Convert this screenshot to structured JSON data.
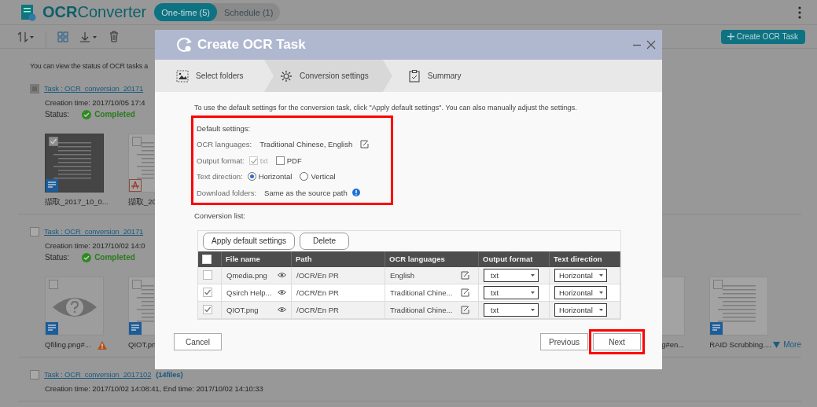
{
  "app": {
    "title": "**OCR**Converter",
    "tabs": [
      {
        "label": "One-time (5)",
        "selected": true
      },
      {
        "label": "Schedule (1)",
        "selected": false
      }
    ]
  },
  "toolbar": {
    "create_button": "Create OCR Task"
  },
  "info_text": "You can view the status of OCR tasks a",
  "tasks": [
    {
      "checked": true,
      "link": "Task : OCR_conversion_20171",
      "time": "Creation time: 2017/10/05 17:4",
      "status_label": "Status:",
      "status": "Completed",
      "thumbnails": [
        {
          "kind": "dark-doc",
          "checked": true,
          "pdf": false,
          "warning": false,
          "label": "擷取_2017_10_0..."
        },
        {
          "kind": "doc-cut",
          "checked": false,
          "pdf": true,
          "warning": false,
          "label": "擷取_20"
        }
      ]
    },
    {
      "checked": false,
      "link": "Task : OCR_conversion_20171",
      "time": "Creation time: 2017/10/02 14:0",
      "status_label": "Status:",
      "status": "Completed",
      "thumbnails": [
        {
          "kind": "unknown",
          "checked": false,
          "pdf": false,
          "warning": true,
          "label": "Qfiling.png#..."
        },
        {
          "kind": "doc-cut",
          "checked": false,
          "pdf": false,
          "warning": false,
          "label": "QIOT.pn"
        }
      ],
      "right_thumbnails": [
        {
          "kind": "doc-edge",
          "warning": false,
          "label": "g#en..."
        },
        {
          "kind": "web-doc",
          "checked": false,
          "pdf": false,
          "warning": false,
          "label": "RAID Scrubbing...."
        }
      ],
      "more": "More"
    },
    {
      "checked": false,
      "link": "Task : OCR_conversion_2017102 ",
      "count": "(14files)",
      "time": "Creation time: 2017/10/02 14:08:41, End time: 2017/10/02 14:10:33"
    }
  ],
  "dialog": {
    "title": "Create OCR Task",
    "steps": [
      {
        "label": "Select folders",
        "selected": false
      },
      {
        "label": "Conversion settings",
        "selected": true
      },
      {
        "label": "Summary",
        "selected": false
      }
    ],
    "intro": "To use the default settings for the conversion task, click \"Apply default settings\". You can also manually adjust the settings.",
    "defaults": {
      "highlighted": true,
      "heading": "Default settings:",
      "languages_label": "OCR languages:",
      "languages": "Traditional Chinese, English",
      "format_label": "Output format:",
      "formats": [
        {
          "label": "txt",
          "checked": true,
          "disabled": true
        },
        {
          "label": "PDF",
          "checked": false,
          "disabled": false
        }
      ],
      "direction_label": "Text direction:",
      "directions": [
        {
          "label": "Horizontal",
          "selected": true
        },
        {
          "label": "Vertical",
          "selected": false
        }
      ],
      "folders_label": "Download folders:",
      "folders": "Same as the source path"
    },
    "list_label": "Conversion list:",
    "list_buttons": [
      "Apply default settings",
      "Delete"
    ],
    "table": {
      "all_checked": false,
      "columns": [
        "File name",
        "Path",
        "OCR languages",
        "Output format",
        "Text direction"
      ],
      "rows": [
        {
          "checked": false,
          "file_name": "Qmedia.png",
          "path": "/OCR/En PR",
          "languages": "English",
          "format": "txt",
          "direction": "Horizontal"
        },
        {
          "checked": true,
          "file_name": "Qsirch Help...",
          "path": "/OCR/En PR",
          "languages": "Traditional Chine...",
          "format": "txt",
          "direction": "Horizontal"
        },
        {
          "checked": true,
          "file_name": "QIOT.png",
          "path": "/OCR/En PR",
          "languages": "Traditional Chine...",
          "format": "txt",
          "direction": "Horizontal"
        }
      ]
    },
    "buttons": [
      {
        "label": "Cancel",
        "highlighted": false
      },
      {
        "label": "Previous",
        "highlighted": false
      },
      {
        "label": "Next",
        "highlighted": true
      }
    ]
  }
}
